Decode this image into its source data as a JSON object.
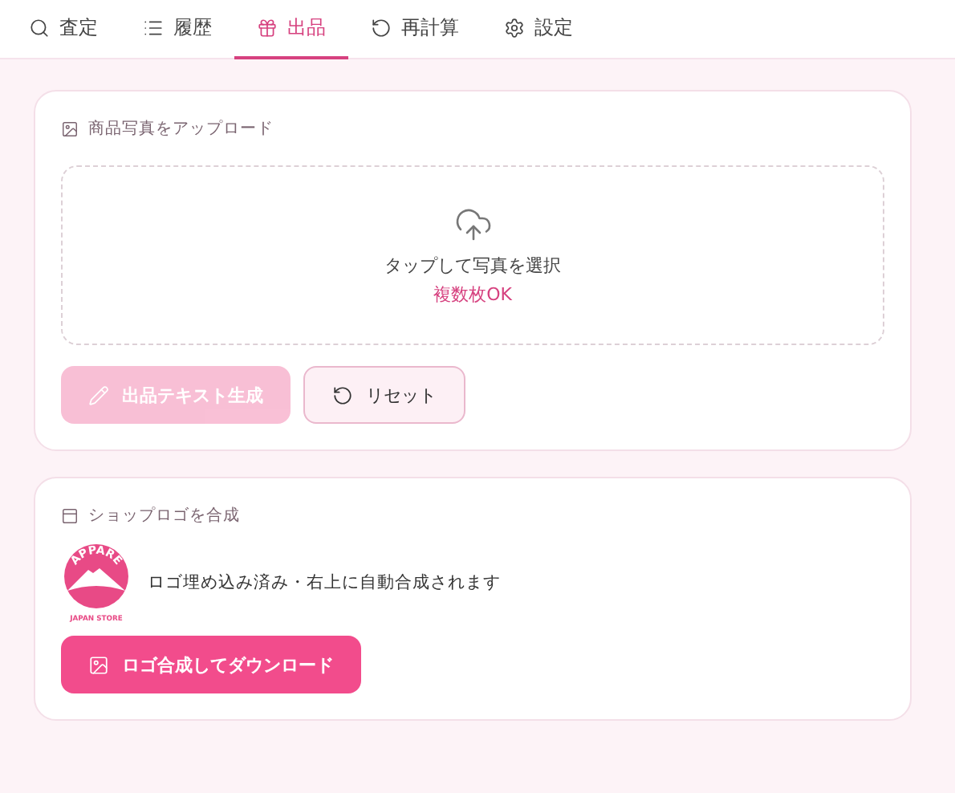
{
  "tabs": [
    {
      "label": "査定",
      "selected": false
    },
    {
      "label": "履歴",
      "selected": false
    },
    {
      "label": "出品",
      "selected": true
    },
    {
      "label": "再計算",
      "selected": false
    },
    {
      "label": "設定",
      "selected": false
    }
  ],
  "upload_card": {
    "title": "商品写真をアップロード",
    "dropzone": {
      "text": "タップして写真を選択",
      "note": "複数枚OK"
    },
    "buttons": [
      {
        "kind": "primary",
        "label": "出品テキスト生成",
        "disabled": true
      },
      {
        "kind": "secondary",
        "label": "リセット",
        "disabled": false
      }
    ]
  },
  "logo_card": {
    "title": "ショップロゴを合成",
    "logo": {
      "arc_text": "APPARE",
      "caption": "JAPAN STORE"
    },
    "description": "ロゴ埋め込み済み・右上に自動合成されます",
    "button": {
      "kind": "primary",
      "label": "ロゴ合成してダウンロード",
      "disabled": false
    }
  }
}
